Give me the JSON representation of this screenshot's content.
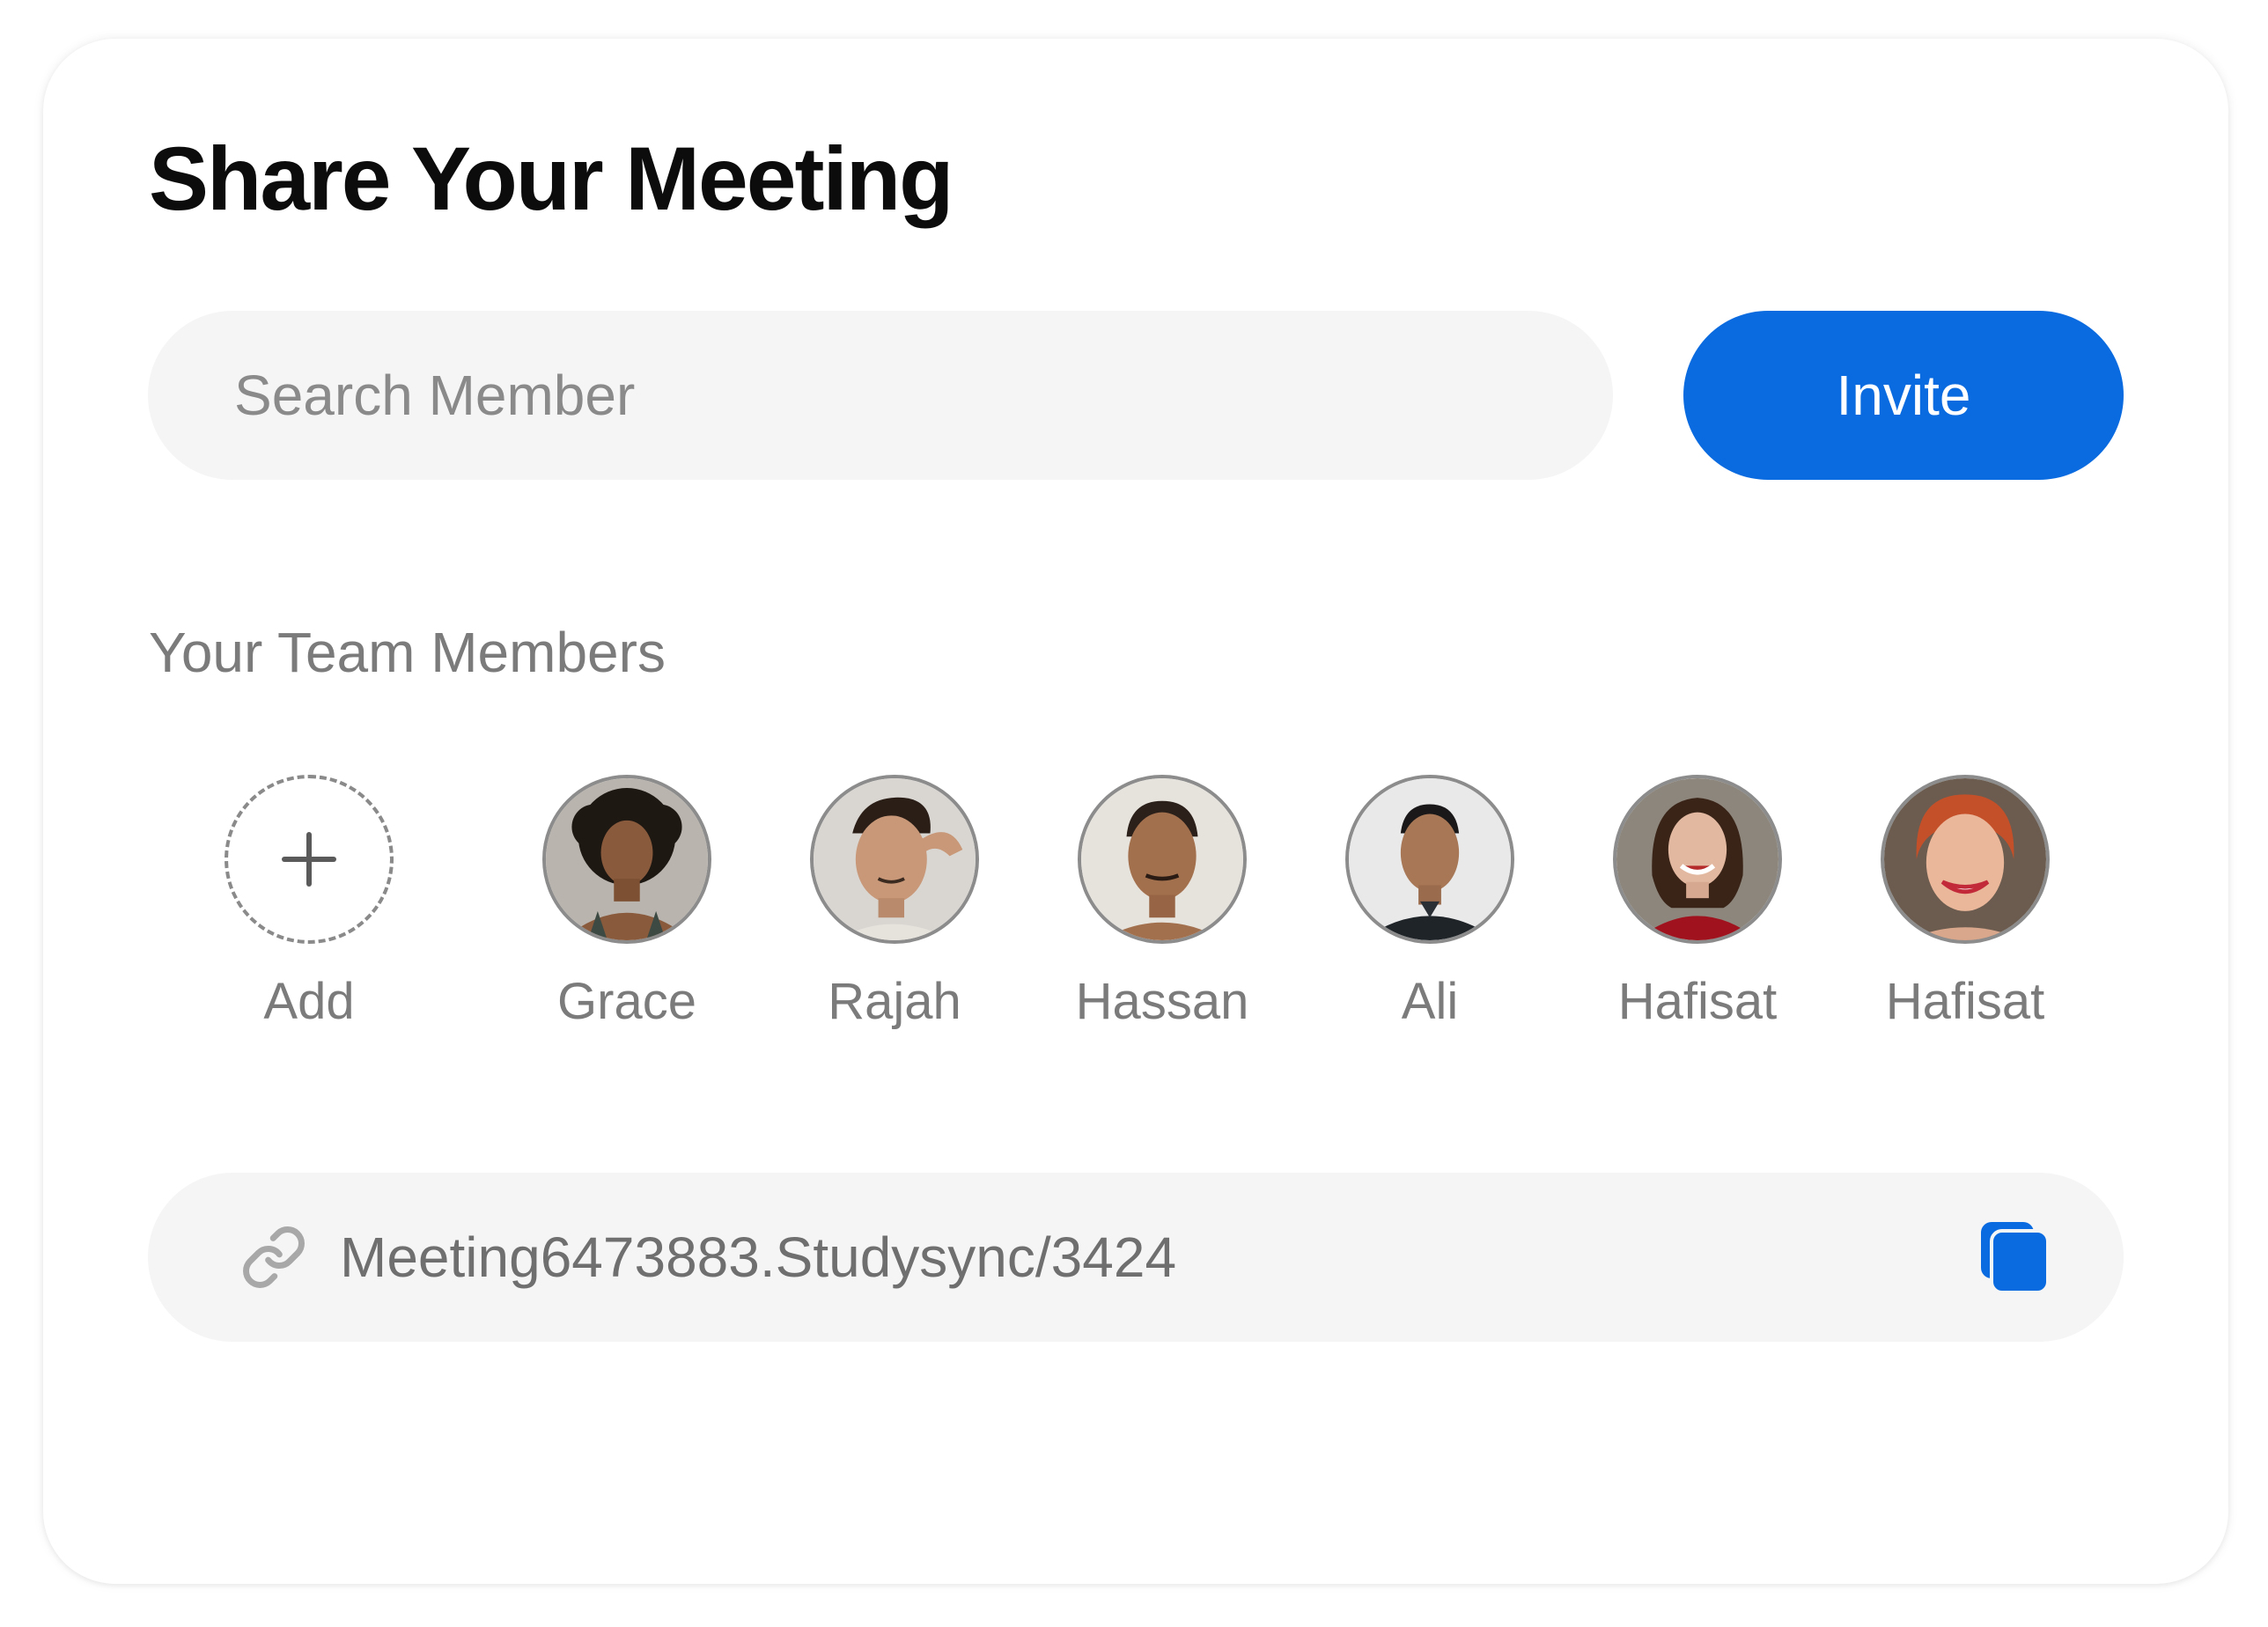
{
  "dialog": {
    "title": "Share Your Meeting"
  },
  "search": {
    "placeholder": "Search Member",
    "value": ""
  },
  "invite_button": {
    "label": "Invite",
    "color": "#0a6be0"
  },
  "team": {
    "heading": "Your Team Members",
    "add_label": "Add",
    "members": [
      {
        "name": "Grace",
        "avatar": "avatar-photo"
      },
      {
        "name": "Rajah",
        "avatar": "avatar-photo"
      },
      {
        "name": "Hassan",
        "avatar": "avatar-photo"
      },
      {
        "name": "Ali",
        "avatar": "avatar-photo"
      },
      {
        "name": "Hafisat",
        "avatar": "avatar-photo"
      },
      {
        "name": "Hafisat",
        "avatar": "avatar-photo"
      }
    ]
  },
  "meeting_link": {
    "url": "Meeting6473883.Studysync/3424",
    "link_icon": "link-icon",
    "copy_icon": "copy-icon"
  }
}
